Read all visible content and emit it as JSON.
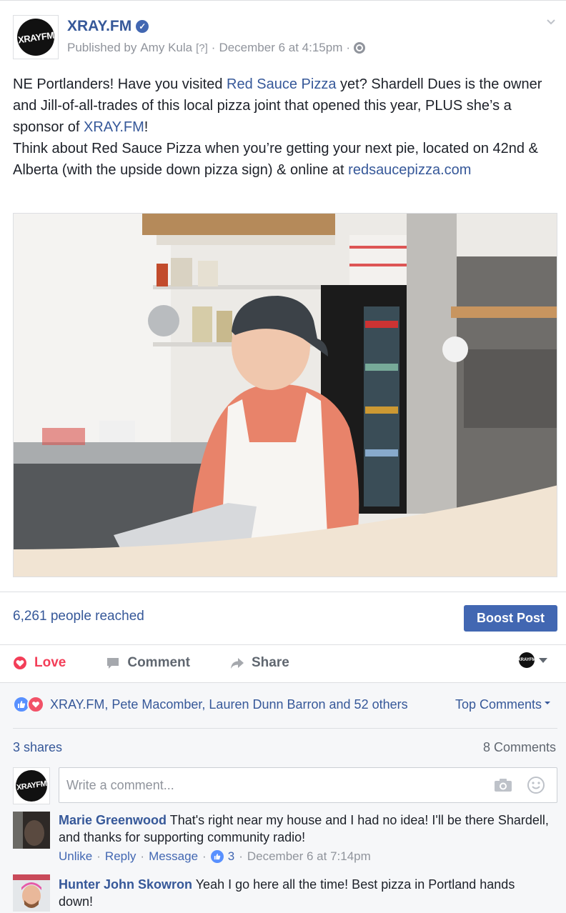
{
  "post": {
    "page_name": "XRAY.FM",
    "logo_text": "XRAYFM",
    "published_by_prefix": "Published by ",
    "author": "Amy Kula",
    "author_help": "[?]",
    "sep": "·",
    "date": "December 6 at 4:15pm",
    "text": {
      "p1_a": "NE Portlanders! Have you visited ",
      "p1_link1": "Red Sauce Pizza",
      "p1_b": " yet? Shardell Dues is the owner and Jill-of-all-trades of this local pizza joint that opened this year, PLUS she’s a sponsor of ",
      "p1_link2": "XRAY.FM",
      "p1_c": "!",
      "p2": "Think about Red Sauce Pizza when you’re getting your next pie, located on 42nd & Alberta (with the upside down pizza sign) & online at ",
      "p2_link": "redsaucepizza.com"
    }
  },
  "insights": {
    "reach_text": "6,261 people reached",
    "boost_label": "Boost Post"
  },
  "actions": {
    "love_label": "Love",
    "comment_label": "Comment",
    "share_label": "Share"
  },
  "reactions": {
    "summary": "XRAY.FM, Pete Macomber, Lauren Dunn Barron and 52 others",
    "top_comments_label": "Top Comments",
    "shares": "3 shares",
    "comments_count": "8 Comments"
  },
  "composer": {
    "placeholder": "Write a comment..."
  },
  "comments": [
    {
      "name": "Marie Greenwood",
      "text": "That's right near my house and I had no idea! I'll be there Shardell, and thanks for supporting community radio!",
      "actions": [
        "Unlike",
        "Reply",
        "Message"
      ],
      "likes": "3",
      "date": "December 6 at 7:14pm"
    },
    {
      "name": "Hunter John Skowron",
      "text": "Yeah I go here all the time! Best pizza in Portland hands down!"
    }
  ],
  "colors": {
    "link": "#365899",
    "boost": "#4267b2",
    "love": "#f33e58",
    "muted": "#90949c"
  }
}
